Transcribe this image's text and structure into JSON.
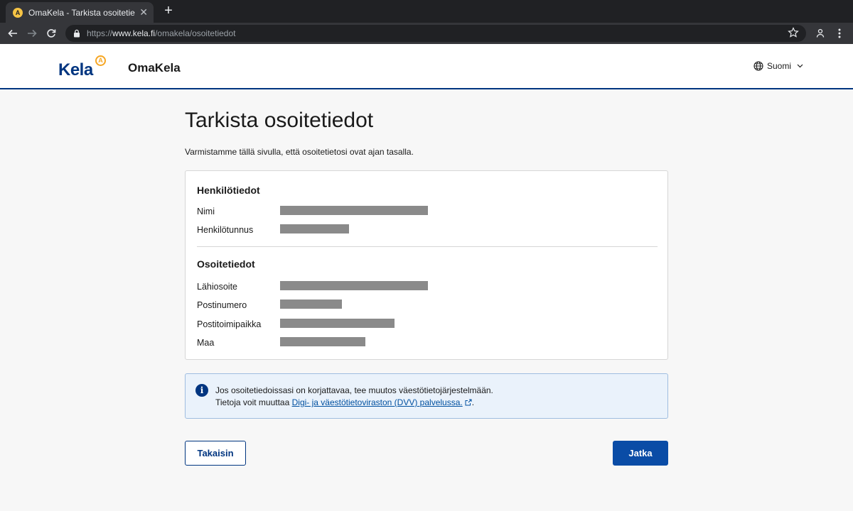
{
  "browser": {
    "tab_title": "OmaKela - Tarkista osoitetiedot",
    "favicon_letter": "A",
    "close_glyph": "✕",
    "new_tab_glyph": "+",
    "url_protocol": "https://",
    "url_host": "www.kela.fi",
    "url_path": "/omakela/osoitetiedot"
  },
  "header": {
    "logo_text": "Kela",
    "logo_badge": "A",
    "app_name": "OmaKela",
    "language": "Suomi"
  },
  "main": {
    "title": "Tarkista osoitetiedot",
    "lead": "Varmistamme tällä sivulla, että osoitetietosi ovat ajan tasalla."
  },
  "personal": {
    "heading": "Henkilötiedot",
    "rows": [
      {
        "label": "Nimi"
      },
      {
        "label": "Henkilötunnus"
      }
    ]
  },
  "address": {
    "heading": "Osoitetiedot",
    "rows": [
      {
        "label": "Lähiosoite"
      },
      {
        "label": "Postinumero"
      },
      {
        "label": "Postitoimipaikka"
      },
      {
        "label": "Maa"
      }
    ]
  },
  "info": {
    "icon": "info-icon",
    "line1": "Jos osoitetiedoissasi on korjattavaa, tee muutos väestötietojärjestelmään.",
    "line2_prefix": "Tietoja voit muuttaa ",
    "link_text": "Digi- ja väestötietoviraston (DVV) palvelussa.",
    "line2_suffix": "."
  },
  "actions": {
    "back_label": "Takaisin",
    "next_label": "Jatka"
  },
  "colors": {
    "brand": "#003580",
    "accent": "#f6a623",
    "primary_button": "#0a4ca6",
    "info_bg": "#eaf2fb"
  }
}
